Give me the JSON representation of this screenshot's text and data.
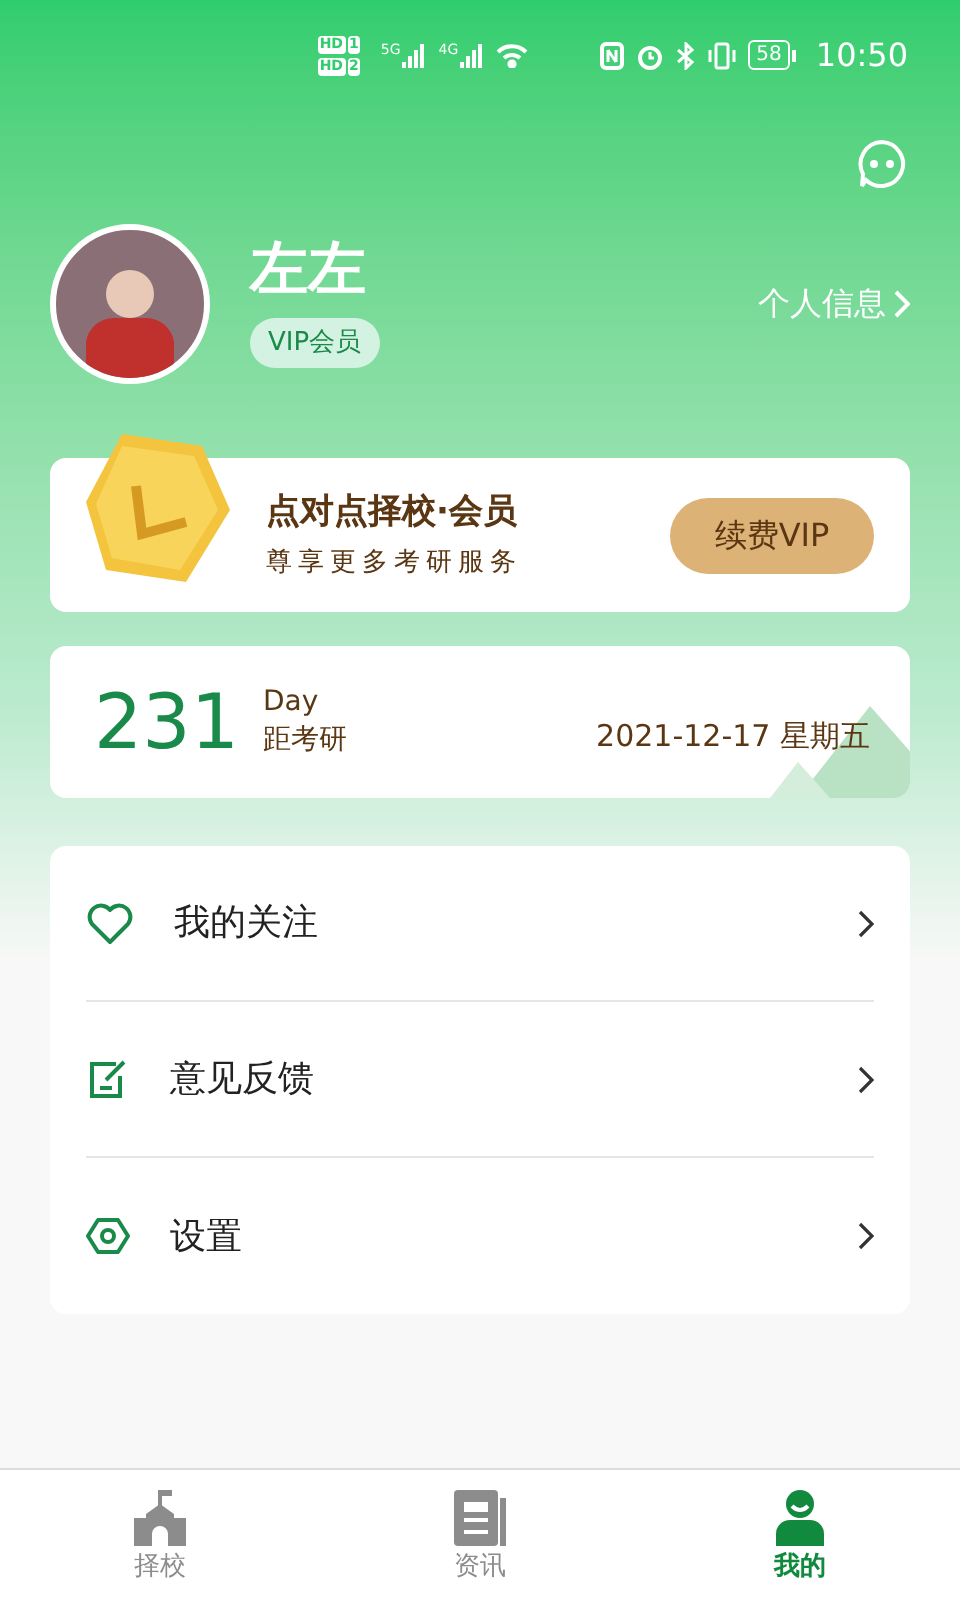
{
  "status_bar": {
    "sim_labels": [
      "HD",
      "HD"
    ],
    "sim_slots": [
      "1",
      "2"
    ],
    "networks": [
      "5G",
      "4G"
    ],
    "battery": "58",
    "time": "10:50"
  },
  "profile": {
    "name": "左左",
    "badge": "VIP会员",
    "link": "个人信息"
  },
  "vip_card": {
    "title": "点对点择校·会员",
    "subtitle": "尊享更多考研服务",
    "button": "续费VIP"
  },
  "countdown": {
    "days": "231",
    "unit": "Day",
    "caption": "距考研",
    "date": "2021-12-17 星期五"
  },
  "menu": [
    {
      "kind": "heart",
      "label": "我的关注"
    },
    {
      "kind": "feedback",
      "label": "意见反馈"
    },
    {
      "kind": "settings",
      "label": "设置"
    }
  ],
  "tabs": [
    {
      "kind": "school",
      "label": "择校",
      "selected": false
    },
    {
      "kind": "news",
      "label": "资讯",
      "selected": false
    },
    {
      "kind": "me",
      "label": "我的",
      "selected": true
    }
  ]
}
